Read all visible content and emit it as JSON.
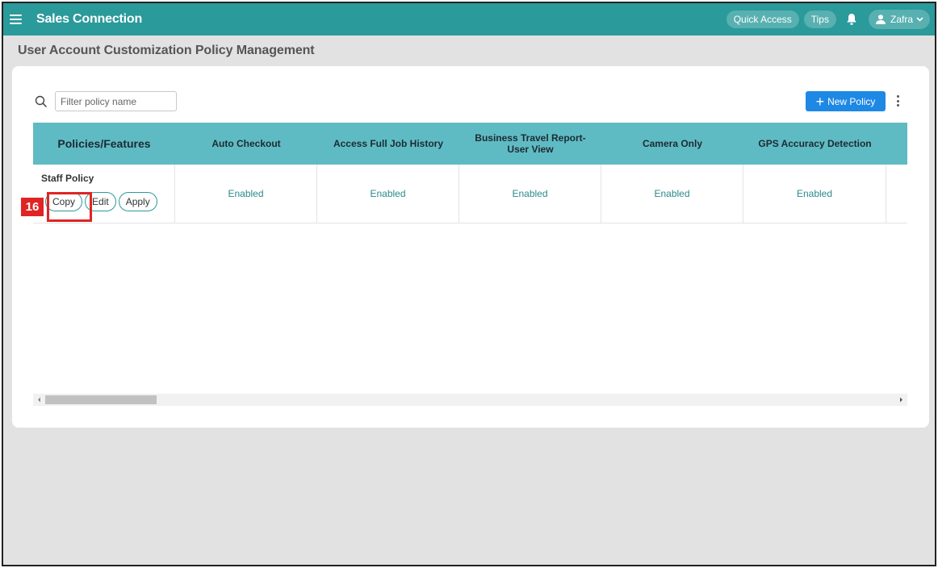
{
  "header": {
    "app_title": "Sales Connection",
    "quick_access_label": "Quick Access",
    "tips_label": "Tips",
    "user_name": "Zafra"
  },
  "page": {
    "title": "User Account Customization Policy Management"
  },
  "toolbar": {
    "filter_placeholder": "Filter policy name",
    "filter_value": "",
    "new_policy_label": "New Policy"
  },
  "table": {
    "columns": [
      "Policies/Features",
      "Auto Checkout",
      "Access Full Job History",
      "Business Travel Report-User View",
      "Camera Only",
      "GPS Accuracy Detection"
    ],
    "rows": [
      {
        "policy_name": "Staff Policy",
        "actions": [
          "Copy",
          "Edit",
          "Apply"
        ],
        "values": [
          "Enabled",
          "Enabled",
          "Enabled",
          "Enabled",
          "Enabled"
        ]
      }
    ]
  },
  "annotation": {
    "label": "16"
  },
  "colors": {
    "topbar": "#2a9a9b",
    "table_header": "#5fbbc3",
    "primary_button": "#1e88e5",
    "highlight": "#e02424"
  }
}
